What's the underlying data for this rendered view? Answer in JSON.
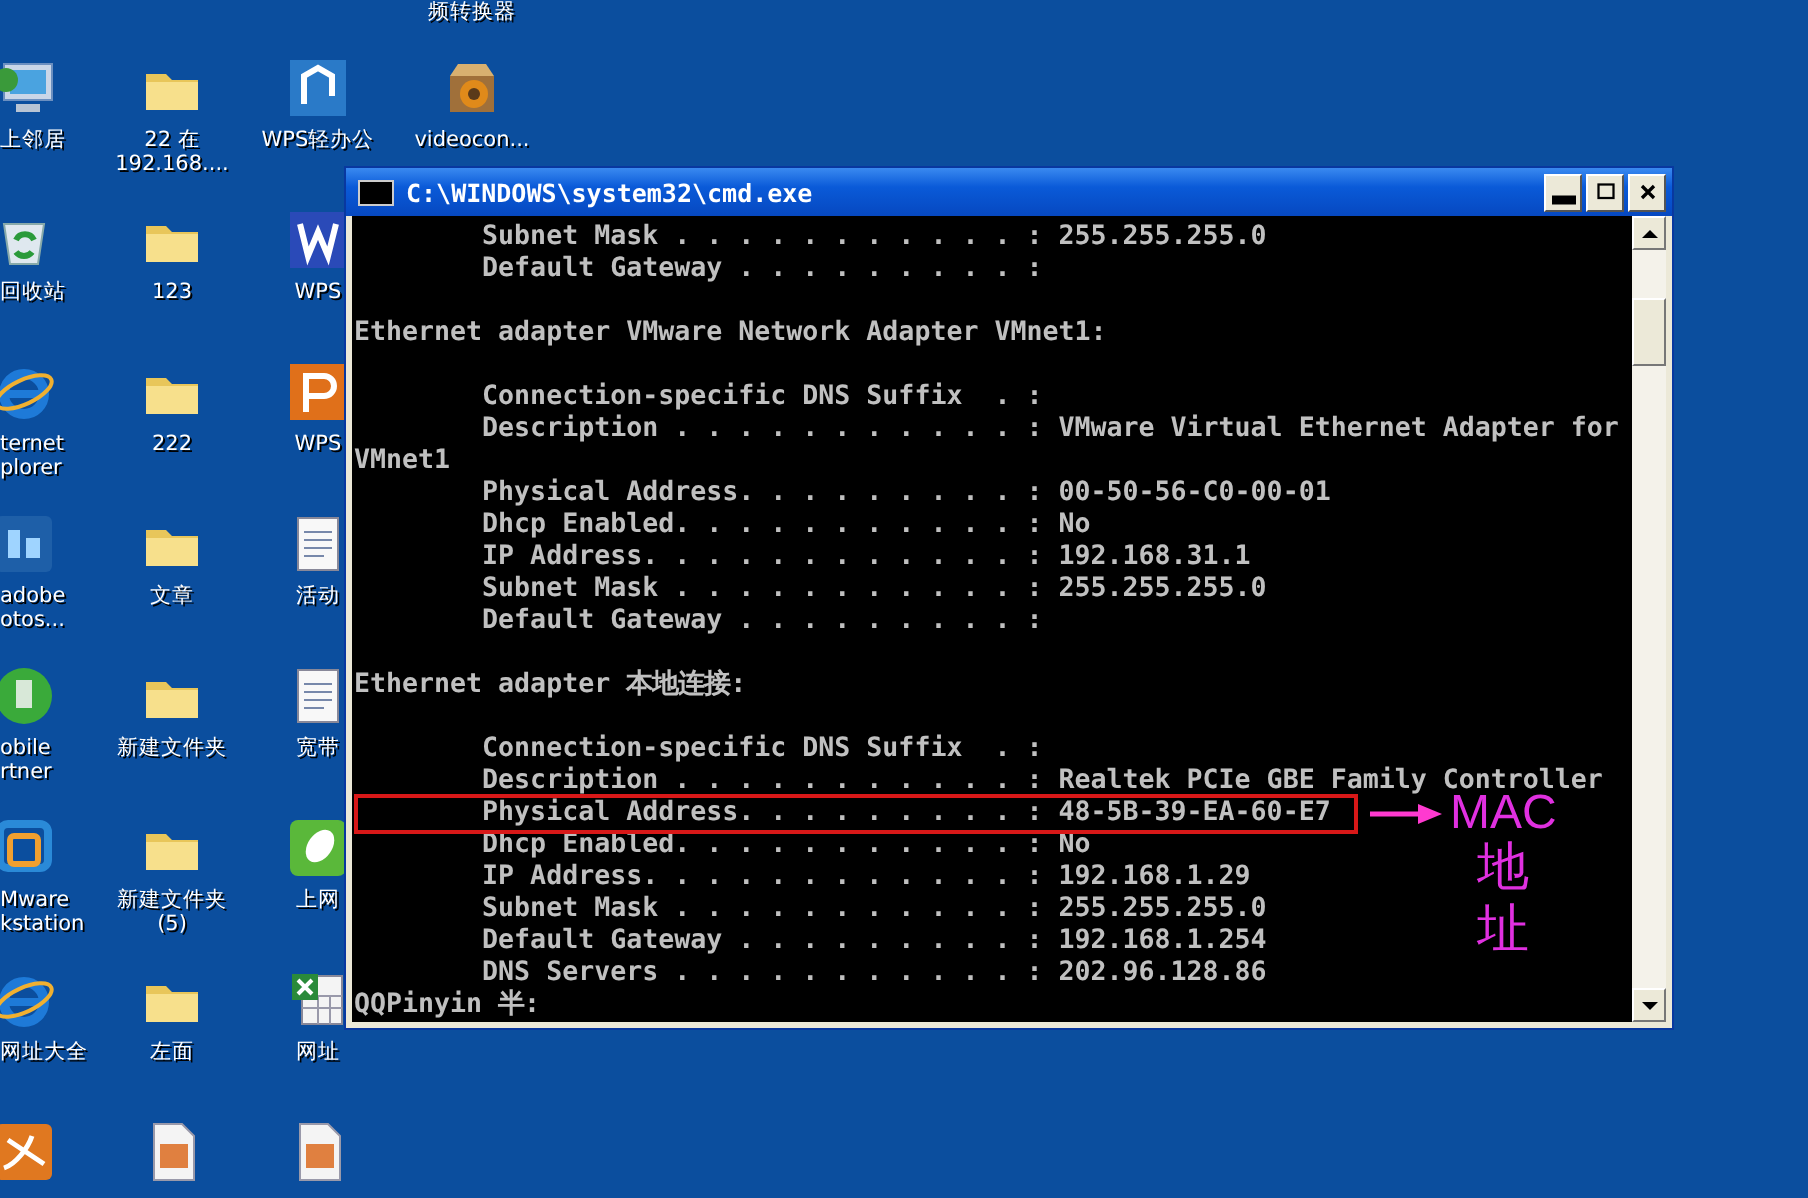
{
  "desktop": {
    "columns": [
      [
        {
          "kind": "computer",
          "label": "上邻居"
        },
        {
          "kind": "recycle",
          "label": "回收站"
        },
        {
          "kind": "browser",
          "label": "ternet\nplorer"
        },
        {
          "kind": "ps",
          "label": "adobe\notos..."
        },
        {
          "kind": "globe",
          "label": "obile\nrtner"
        },
        {
          "kind": "vm",
          "label": "Mware\nkstation"
        },
        {
          "kind": "browser",
          "label": "网址大全"
        },
        {
          "kind": "pdf"
        }
      ],
      [
        {
          "kind": "folder",
          "label": "22 在\n192.168...."
        },
        {
          "kind": "folder",
          "label": "123"
        },
        {
          "kind": "folder",
          "label": "222"
        },
        {
          "kind": "folder",
          "label": "文章"
        },
        {
          "kind": "folder",
          "label": "新建文件夹"
        },
        {
          "kind": "folder",
          "label": "新建文件夹\n(5)"
        },
        {
          "kind": "folder",
          "label": "左面"
        },
        {
          "kind": "image"
        }
      ],
      [
        {
          "kind": "wps",
          "label": "WPS轻办公"
        },
        {
          "kind": "wpsw",
          "label": "WPS"
        },
        {
          "kind": "wpsp",
          "label": "WPS"
        },
        {
          "kind": "doc",
          "label": "活动"
        },
        {
          "kind": "doc",
          "label": "宽带"
        },
        {
          "kind": "speed",
          "label": "上网"
        },
        {
          "kind": "excel",
          "label": "网址"
        },
        {
          "kind": "image"
        }
      ],
      [
        {
          "kind": "label-only",
          "label": "频转换器"
        },
        {
          "kind": "video",
          "label": "videocon..."
        }
      ]
    ]
  },
  "window": {
    "title": "C:\\WINDOWS\\system32\\cmd.exe",
    "blocks": [
      {
        "lines": [
          {
            "text": "        Subnet Mask . . . . . . . . . . . : 255.255.255.0",
            "highlighted": false
          },
          {
            "text": "        Default Gateway . . . . . . . . . :",
            "highlighted": false
          }
        ]
      },
      {
        "lines": [
          {
            "text": "Ethernet adapter VMware Network Adapter VMnet1:",
            "highlighted": false
          }
        ]
      },
      {
        "lines": [
          {
            "text": "        Connection-specific DNS Suffix  . :",
            "highlighted": false
          },
          {
            "text": "        Description . . . . . . . . . . . : VMware Virtual Ethernet Adapter for",
            "highlighted": false
          },
          {
            "text": "VMnet1",
            "highlighted": false
          },
          {
            "text": "        Physical Address. . . . . . . . . : 00-50-56-C0-00-01",
            "highlighted": false
          },
          {
            "text": "        Dhcp Enabled. . . . . . . . . . . : No",
            "highlighted": false
          },
          {
            "text": "        IP Address. . . . . . . . . . . . : 192.168.31.1",
            "highlighted": false
          },
          {
            "text": "        Subnet Mask . . . . . . . . . . . : 255.255.255.0",
            "highlighted": false
          },
          {
            "text": "        Default Gateway . . . . . . . . . :",
            "highlighted": false
          }
        ]
      },
      {
        "lines": [
          {
            "text": "Ethernet adapter 本地连接:",
            "highlighted": false
          }
        ]
      },
      {
        "lines": [
          {
            "text": "        Connection-specific DNS Suffix  . :",
            "highlighted": false
          },
          {
            "text": "        Description . . . . . . . . . . . : Realtek PCIe GBE Family Controller",
            "highlighted": false
          },
          {
            "text": "        Physical Address. . . . . . . . . : 48-5B-39-EA-60-E7",
            "highlighted": true
          },
          {
            "text": "        Dhcp Enabled. . . . . . . . . . . : No",
            "highlighted": false
          },
          {
            "text": "        IP Address. . . . . . . . . . . . : 192.168.1.29",
            "highlighted": false
          },
          {
            "text": "        Subnet Mask . . . . . . . . . . . : 255.255.255.0",
            "highlighted": false
          },
          {
            "text": "        Default Gateway . . . . . . . . . : 192.168.1.254",
            "highlighted": false
          },
          {
            "text": "        DNS Servers . . . . . . . . . . . : 202.96.128.86",
            "highlighted": false
          },
          {
            "text": "QQPinyin 半:",
            "highlighted": false
          }
        ]
      }
    ],
    "annotation": {
      "label": "MAC",
      "caption": "地址"
    }
  }
}
